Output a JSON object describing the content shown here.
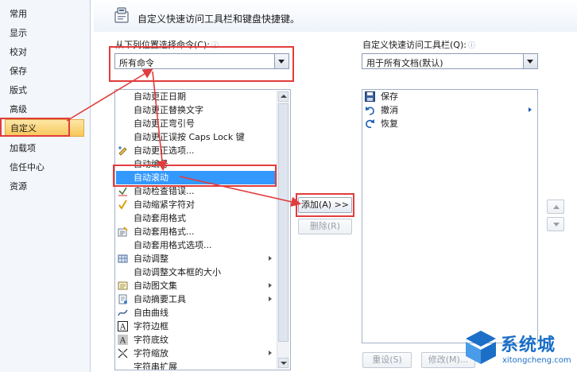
{
  "sidebar": {
    "items": [
      {
        "label": "常用"
      },
      {
        "label": "显示"
      },
      {
        "label": "校对"
      },
      {
        "label": "保存"
      },
      {
        "label": "版式"
      },
      {
        "label": "高级"
      },
      {
        "label": "自定义",
        "selected": true
      },
      {
        "label": "加载项"
      },
      {
        "label": "信任中心"
      },
      {
        "label": "资源"
      }
    ]
  },
  "header": {
    "title": "自定义快速访问工具栏和键盘快捷键。",
    "icon": "toolbar-customize-icon"
  },
  "left_panel": {
    "label": "从下列位置选择命令(C):",
    "info_icon": "ⓘ",
    "combo_value": "所有命令",
    "commands": [
      {
        "label": "自动更正日期",
        "icon": ""
      },
      {
        "label": "自动更正替换文字",
        "icon": ""
      },
      {
        "label": "自动更正弯引号",
        "icon": ""
      },
      {
        "label": "自动更正误按 Caps Lock 键",
        "icon": ""
      },
      {
        "label": "自动更正选项...",
        "icon": "autocorrect-options-icon"
      },
      {
        "label": "自动编号",
        "icon": ""
      },
      {
        "label": "自动滚动",
        "icon": "",
        "selected": true
      },
      {
        "label": "自动检查错误...",
        "icon": "check-errors-icon"
      },
      {
        "label": "自动缩紧字符对",
        "icon": "checkmark-icon"
      },
      {
        "label": "自动套用格式",
        "icon": ""
      },
      {
        "label": "自动套用格式...",
        "icon": "autoformat-icon"
      },
      {
        "label": "自动套用格式选项...",
        "icon": ""
      },
      {
        "label": "自动调整",
        "icon": "autofit-icon",
        "submenu": true
      },
      {
        "label": "自动调整文本框的大小",
        "icon": ""
      },
      {
        "label": "自动图文集",
        "icon": "autotext-icon",
        "submenu": true
      },
      {
        "label": "自动摘要工具",
        "icon": "autosummary-icon",
        "submenu": true
      },
      {
        "label": "自由曲线",
        "icon": "freeform-icon"
      },
      {
        "label": "字符边框",
        "icon": "char-border-icon"
      },
      {
        "label": "字符底纹",
        "icon": "char-shading-icon"
      },
      {
        "label": "字符缩放",
        "icon": "char-scale-icon",
        "submenu": true
      },
      {
        "label": "字符串扩展",
        "icon": ""
      }
    ]
  },
  "middle": {
    "add_label": "添加(A) >>",
    "remove_label": "删除(R)"
  },
  "right_panel": {
    "label": "自定义快速访问工具栏(Q):",
    "info_icon": "ⓘ",
    "combo_value": "用于所有文档(默认)",
    "items": [
      {
        "label": "保存",
        "icon": "save-icon"
      },
      {
        "label": "撤消",
        "icon": "undo-icon",
        "submenu": true
      },
      {
        "label": "恢复",
        "icon": "redo-icon"
      }
    ]
  },
  "bottom": {
    "reset_label": "重设(S)",
    "modify_label": "修改(M)..."
  },
  "watermark": {
    "brand": "系统城",
    "url": "xitongcheng.com"
  },
  "colors": {
    "selection": "#3399ff",
    "sidebar_selected": "#f8c75a",
    "annotation": "#e23c3c",
    "brand": "#1b6fc7"
  }
}
